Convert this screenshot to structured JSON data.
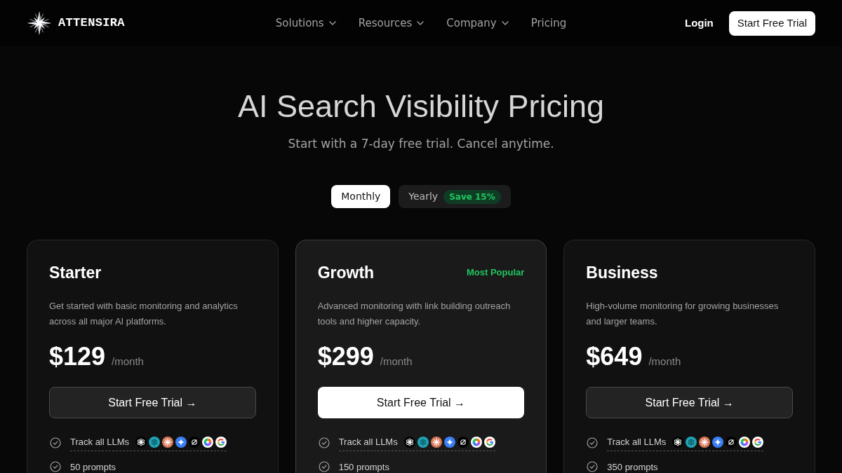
{
  "brand": {
    "name": "ATTENSIRA"
  },
  "nav": {
    "links": [
      {
        "label": "Solutions",
        "dropdown": true
      },
      {
        "label": "Resources",
        "dropdown": true
      },
      {
        "label": "Company",
        "dropdown": true
      },
      {
        "label": "Pricing",
        "dropdown": false
      }
    ],
    "login": "Login",
    "cta": "Start Free Trial"
  },
  "hero": {
    "title": "AI Search Visibility Pricing",
    "subtitle": "Start with a 7-day free trial. Cancel anytime."
  },
  "billing": [
    {
      "label": "Monthly",
      "selected": true
    },
    {
      "label": "Yearly",
      "selected": false,
      "badge": "Save 15%"
    }
  ],
  "plans": [
    {
      "name": "Starter",
      "featured": false,
      "description": "Get started with basic monitoring and analytics across all major AI platforms.",
      "price": "$129",
      "period": "/month",
      "button": "Start Free Trial →",
      "features": [
        {
          "kind": "llms",
          "text": "Track all LLMs"
        },
        {
          "kind": "plain",
          "text": "50 prompts"
        }
      ]
    },
    {
      "name": "Growth",
      "featured": true,
      "badge": "Most Popular",
      "description": "Advanced monitoring with link building outreach tools and higher capacity.",
      "price": "$299",
      "period": "/month",
      "button": "Start Free Trial →",
      "features": [
        {
          "kind": "llms",
          "text": "Track all LLMs"
        },
        {
          "kind": "plain",
          "text": "150 prompts"
        }
      ]
    },
    {
      "name": "Business",
      "featured": false,
      "description": "High-volume monitoring for growing businesses and larger teams.",
      "price": "$649",
      "period": "/month",
      "button": "Start Free Trial →",
      "features": [
        {
          "kind": "llms",
          "text": "Track all LLMs"
        },
        {
          "kind": "plain",
          "text": "350 prompts"
        }
      ]
    }
  ]
}
